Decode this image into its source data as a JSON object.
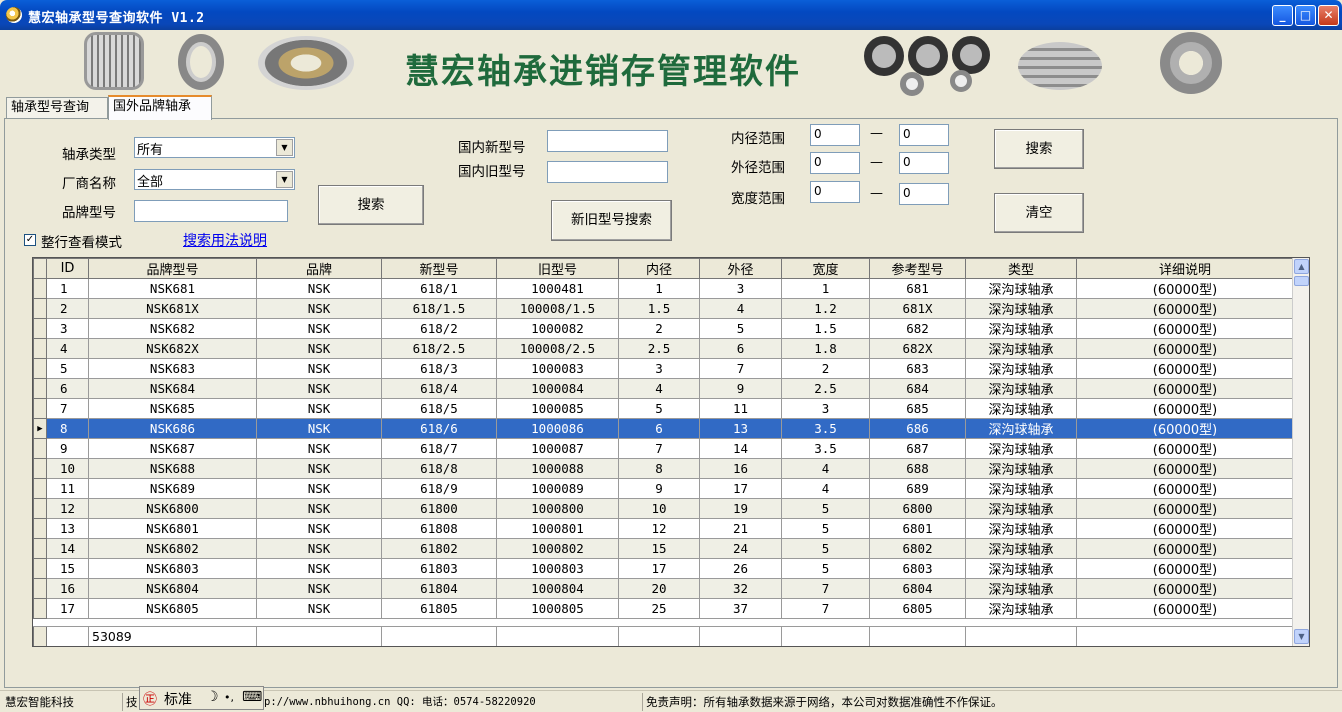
{
  "window": {
    "title": "慧宏轴承型号查询软件 V1.2",
    "minimize": "_",
    "maximize": "□",
    "close": "✕"
  },
  "banner": {
    "slogan": "慧宏轴承进销存管理软件"
  },
  "tabs": [
    {
      "label": "轴承型号查询"
    },
    {
      "label": "国外品牌轴承"
    }
  ],
  "filters": {
    "type_label": "轴承类型",
    "type_value": "所有",
    "maker_label": "厂商名称",
    "maker_value": "全部",
    "brand_label": "品牌型号",
    "brand_value": "",
    "search_label": "搜索",
    "domestic_new_label": "国内新型号",
    "domestic_new_value": "",
    "domestic_old_label": "国内旧型号",
    "domestic_old_value": "",
    "newold_search_label": "新旧型号搜索",
    "inner_label": "内径范围",
    "inner_from": "0",
    "inner_to": "0",
    "outer_label": "外径范围",
    "outer_from": "0",
    "outer_to": "0",
    "width_label": "宽度范围",
    "width_from": "0",
    "width_to": "0",
    "range_dash": "—",
    "search2_label": "搜索",
    "clear_label": "清空",
    "row_mode_label": "整行查看模式",
    "row_mode_checked": "✓",
    "help_link": "搜索用法说明"
  },
  "grid": {
    "columns": [
      "ID",
      "品牌型号",
      "品牌",
      "新型号",
      "旧型号",
      "内径",
      "外径",
      "宽度",
      "参考型号",
      "类型",
      "详细说明"
    ],
    "rows": [
      [
        "1",
        "NSK681",
        "NSK",
        "618/1",
        "1000481",
        "1",
        "3",
        "1",
        "681",
        "深沟球轴承",
        "(60000型)"
      ],
      [
        "2",
        "NSK681X",
        "NSK",
        "618/1.5",
        "100008/1.5",
        "1.5",
        "4",
        "1.2",
        "681X",
        "深沟球轴承",
        "(60000型)"
      ],
      [
        "3",
        "NSK682",
        "NSK",
        "618/2",
        "1000082",
        "2",
        "5",
        "1.5",
        "682",
        "深沟球轴承",
        "(60000型)"
      ],
      [
        "4",
        "NSK682X",
        "NSK",
        "618/2.5",
        "100008/2.5",
        "2.5",
        "6",
        "1.8",
        "682X",
        "深沟球轴承",
        "(60000型)"
      ],
      [
        "5",
        "NSK683",
        "NSK",
        "618/3",
        "1000083",
        "3",
        "7",
        "2",
        "683",
        "深沟球轴承",
        "(60000型)"
      ],
      [
        "6",
        "NSK684",
        "NSK",
        "618/4",
        "1000084",
        "4",
        "9",
        "2.5",
        "684",
        "深沟球轴承",
        "(60000型)"
      ],
      [
        "7",
        "NSK685",
        "NSK",
        "618/5",
        "1000085",
        "5",
        "11",
        "3",
        "685",
        "深沟球轴承",
        "(60000型)"
      ],
      [
        "8",
        "NSK686",
        "NSK",
        "618/6",
        "1000086",
        "6",
        "13",
        "3.5",
        "686",
        "深沟球轴承",
        "(60000型)"
      ],
      [
        "9",
        "NSK687",
        "NSK",
        "618/7",
        "1000087",
        "7",
        "14",
        "3.5",
        "687",
        "深沟球轴承",
        "(60000型)"
      ],
      [
        "10",
        "NSK688",
        "NSK",
        "618/8",
        "1000088",
        "8",
        "16",
        "4",
        "688",
        "深沟球轴承",
        "(60000型)"
      ],
      [
        "11",
        "NSK689",
        "NSK",
        "618/9",
        "1000089",
        "9",
        "17",
        "4",
        "689",
        "深沟球轴承",
        "(60000型)"
      ],
      [
        "12",
        "NSK6800",
        "NSK",
        "61800",
        "1000800",
        "10",
        "19",
        "5",
        "6800",
        "深沟球轴承",
        "(60000型)"
      ],
      [
        "13",
        "NSK6801",
        "NSK",
        "61808",
        "1000801",
        "12",
        "21",
        "5",
        "6801",
        "深沟球轴承",
        "(60000型)"
      ],
      [
        "14",
        "NSK6802",
        "NSK",
        "61802",
        "1000802",
        "15",
        "24",
        "5",
        "6802",
        "深沟球轴承",
        "(60000型)"
      ],
      [
        "15",
        "NSK6803",
        "NSK",
        "61803",
        "1000803",
        "17",
        "26",
        "5",
        "6803",
        "深沟球轴承",
        "(60000型)"
      ],
      [
        "16",
        "NSK6804",
        "NSK",
        "61804",
        "1000804",
        "20",
        "32",
        "7",
        "6804",
        "深沟球轴承",
        "(60000型)"
      ],
      [
        "17",
        "NSK6805",
        "NSK",
        "61805",
        "1000805",
        "25",
        "37",
        "7",
        "6805",
        "深沟球轴承",
        "(60000型)"
      ]
    ],
    "selected_row_id": "8",
    "selected_marker": "▶",
    "total": "53089"
  },
  "statusbar": {
    "company": "慧宏智能科技",
    "tech_prefix": "技",
    "website": "p://www.nbhuihong.cn  QQ:  电话：0574-58220920",
    "disclaimer": "免责声明：所有轴承数据来源于网络，本公司对数据准确性不作保证。"
  },
  "ime": {
    "logo": "㊣",
    "mode": "标准",
    "moon": "☽",
    "punct": "•,",
    "keyboard": "⌨"
  },
  "colors": {
    "selection": "#316ac5",
    "slogan": "#1f6a3c",
    "titlebar": "#0348c0",
    "link": "#0000ee"
  }
}
